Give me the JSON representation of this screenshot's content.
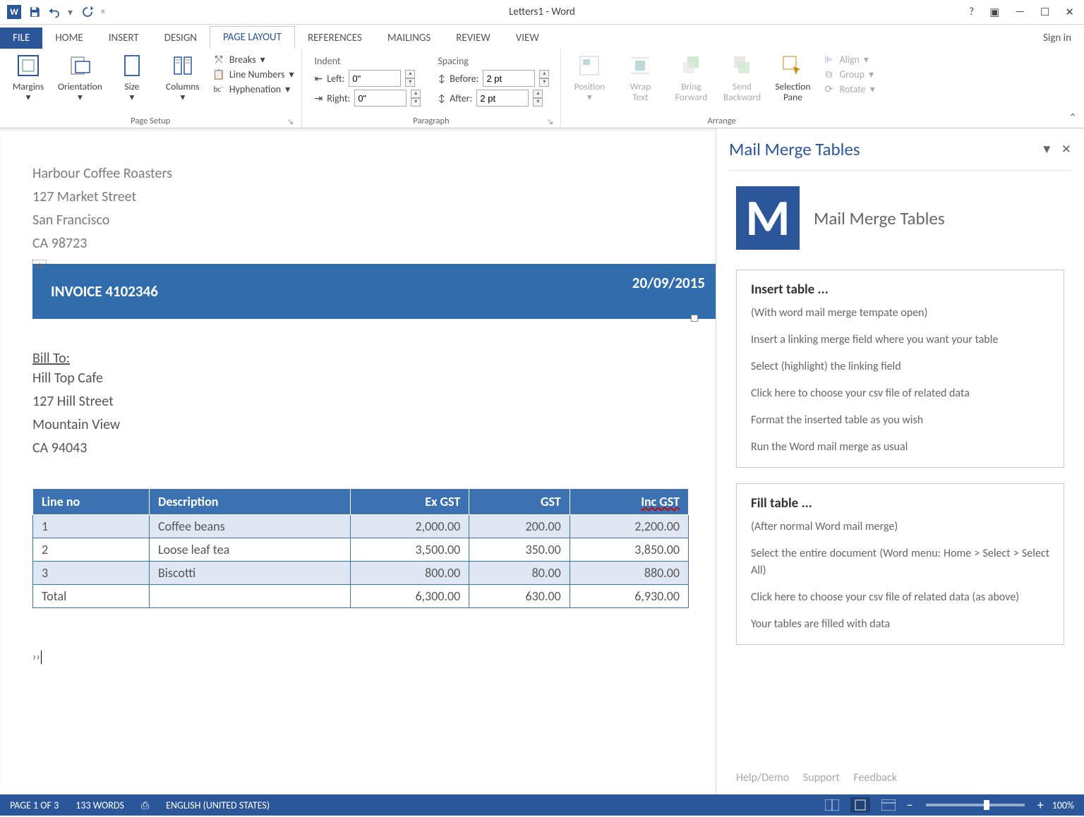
{
  "app": {
    "title": "Letters1 - Word",
    "signin": "Sign in"
  },
  "qat": {
    "save": "save",
    "undo": "undo",
    "redo": "redo"
  },
  "tabs": {
    "file": "FILE",
    "home": "HOME",
    "insert": "INSERT",
    "design": "DESIGN",
    "pagelayout": "PAGE LAYOUT",
    "references": "REFERENCES",
    "mailings": "MAILINGS",
    "review": "REVIEW",
    "view": "VIEW"
  },
  "ribbon": {
    "pageSetup": {
      "label": "Page Setup",
      "margins": "Margins",
      "orientation": "Orientation",
      "size": "Size",
      "columns": "Columns",
      "breaks": "Breaks",
      "lineNumbers": "Line Numbers",
      "hyphenation": "Hyphenation"
    },
    "paragraph": {
      "label": "Paragraph",
      "indentHeader": "Indent",
      "spacingHeader": "Spacing",
      "left": "Left:",
      "right": "Right:",
      "before": "Before:",
      "after": "After:",
      "leftVal": "0\"",
      "rightVal": "0\"",
      "beforeVal": "2 pt",
      "afterVal": "2 pt"
    },
    "arrange": {
      "label": "Arrange",
      "position": "Position",
      "wrapText": "Wrap\nText",
      "bringForward": "Bring\nForward",
      "sendBackward": "Send\nBackward",
      "selectionPane": "Selection\nPane",
      "align": "Align",
      "group": "Group",
      "rotate": "Rotate"
    }
  },
  "doc": {
    "sender": [
      "Harbour Coffee Roasters",
      "127 Market Street",
      "San Francisco",
      "CA 98723"
    ],
    "invoice": "INVOICE 4102346",
    "date": "20/09/2015",
    "billTo": "Bill To:",
    "receiver": [
      "Hill Top Cafe",
      "127 Hill Street",
      "Mountain View",
      "CA 94043"
    ],
    "cols": {
      "lineno": "Line no",
      "desc": "Description",
      "ex": "Ex GST",
      "gst": "GST",
      "inc": "Inc GST"
    },
    "rows": [
      {
        "n": "1",
        "d": "Coffee beans",
        "ex": "2,000.00",
        "g": "200.00",
        "inc": "2,200.00"
      },
      {
        "n": "2",
        "d": "Loose leaf tea",
        "ex": "3,500.00",
        "g": "350.00",
        "inc": "3,850.00"
      },
      {
        "n": "3",
        "d": "Biscotti",
        "ex": "800.00",
        "g": "80.00",
        "inc": "880.00"
      }
    ],
    "total": {
      "label": "Total",
      "ex": "6,300.00",
      "g": "630.00",
      "inc": "6,930.00"
    },
    "cursor": "››"
  },
  "pane": {
    "title": "Mail Merge Tables",
    "brand": "Mail Merge Tables",
    "card1": {
      "h": "Insert table ...",
      "p1": "(With word mail merge tempate open)",
      "p2": "Insert a linking merge field where you want your table",
      "p3": "Select (highlight) the linking field",
      "p4": "Click here to choose your csv file of related data",
      "p5": "Format the inserted table as you wish",
      "p6": "Run the Word mail merge as usual"
    },
    "card2": {
      "h": "Fill table ...",
      "p1": "(After normal Word mail merge)",
      "p2": "Select the entire document (Word menu: Home > Select > Select All)",
      "p3": "Click here to choose your csv file of related data (as above)",
      "p4": "Your tables are filled with data"
    },
    "foot": {
      "help": "Help/Demo",
      "support": "Support",
      "feedback": "Feedback"
    }
  },
  "status": {
    "page": "PAGE 1 OF 3",
    "words": "133 WORDS",
    "lang": "ENGLISH (UNITED STATES)",
    "zoom": "100%"
  }
}
